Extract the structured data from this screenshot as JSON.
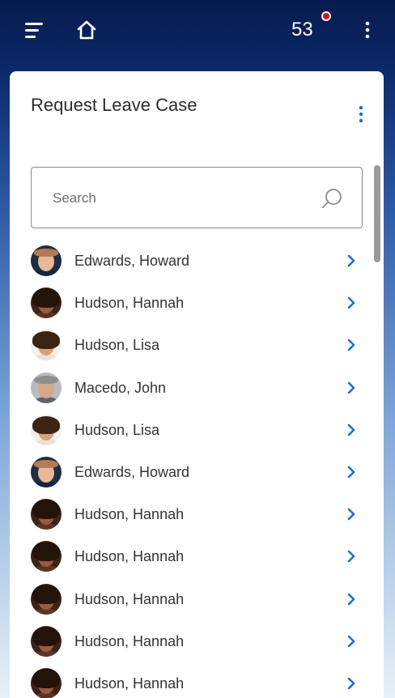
{
  "header": {
    "notification_count": "53",
    "accent_color": "#d4102a",
    "icons": [
      "menu-icon",
      "home-icon",
      "notification-badge",
      "more-vertical-icon"
    ]
  },
  "card": {
    "title": "Request Leave Case",
    "search": {
      "placeholder": "Search",
      "value": ""
    },
    "items": [
      {
        "name": "Edwards, Howard",
        "avatar": "howard"
      },
      {
        "name": "Hudson, Hannah",
        "avatar": "hannah"
      },
      {
        "name": "Hudson, Lisa",
        "avatar": "lisa"
      },
      {
        "name": "Macedo, John",
        "avatar": "john"
      },
      {
        "name": "Hudson, Lisa",
        "avatar": "lisa"
      },
      {
        "name": "Edwards, Howard",
        "avatar": "howard"
      },
      {
        "name": "Hudson, Hannah",
        "avatar": "hannah"
      },
      {
        "name": "Hudson, Hannah",
        "avatar": "hannah"
      },
      {
        "name": "Hudson, Hannah",
        "avatar": "hannah"
      },
      {
        "name": "Hudson, Hannah",
        "avatar": "hannah"
      },
      {
        "name": "Hudson, Hannah",
        "avatar": "hannah"
      }
    ],
    "chevron_color": "#1b6fd6"
  }
}
